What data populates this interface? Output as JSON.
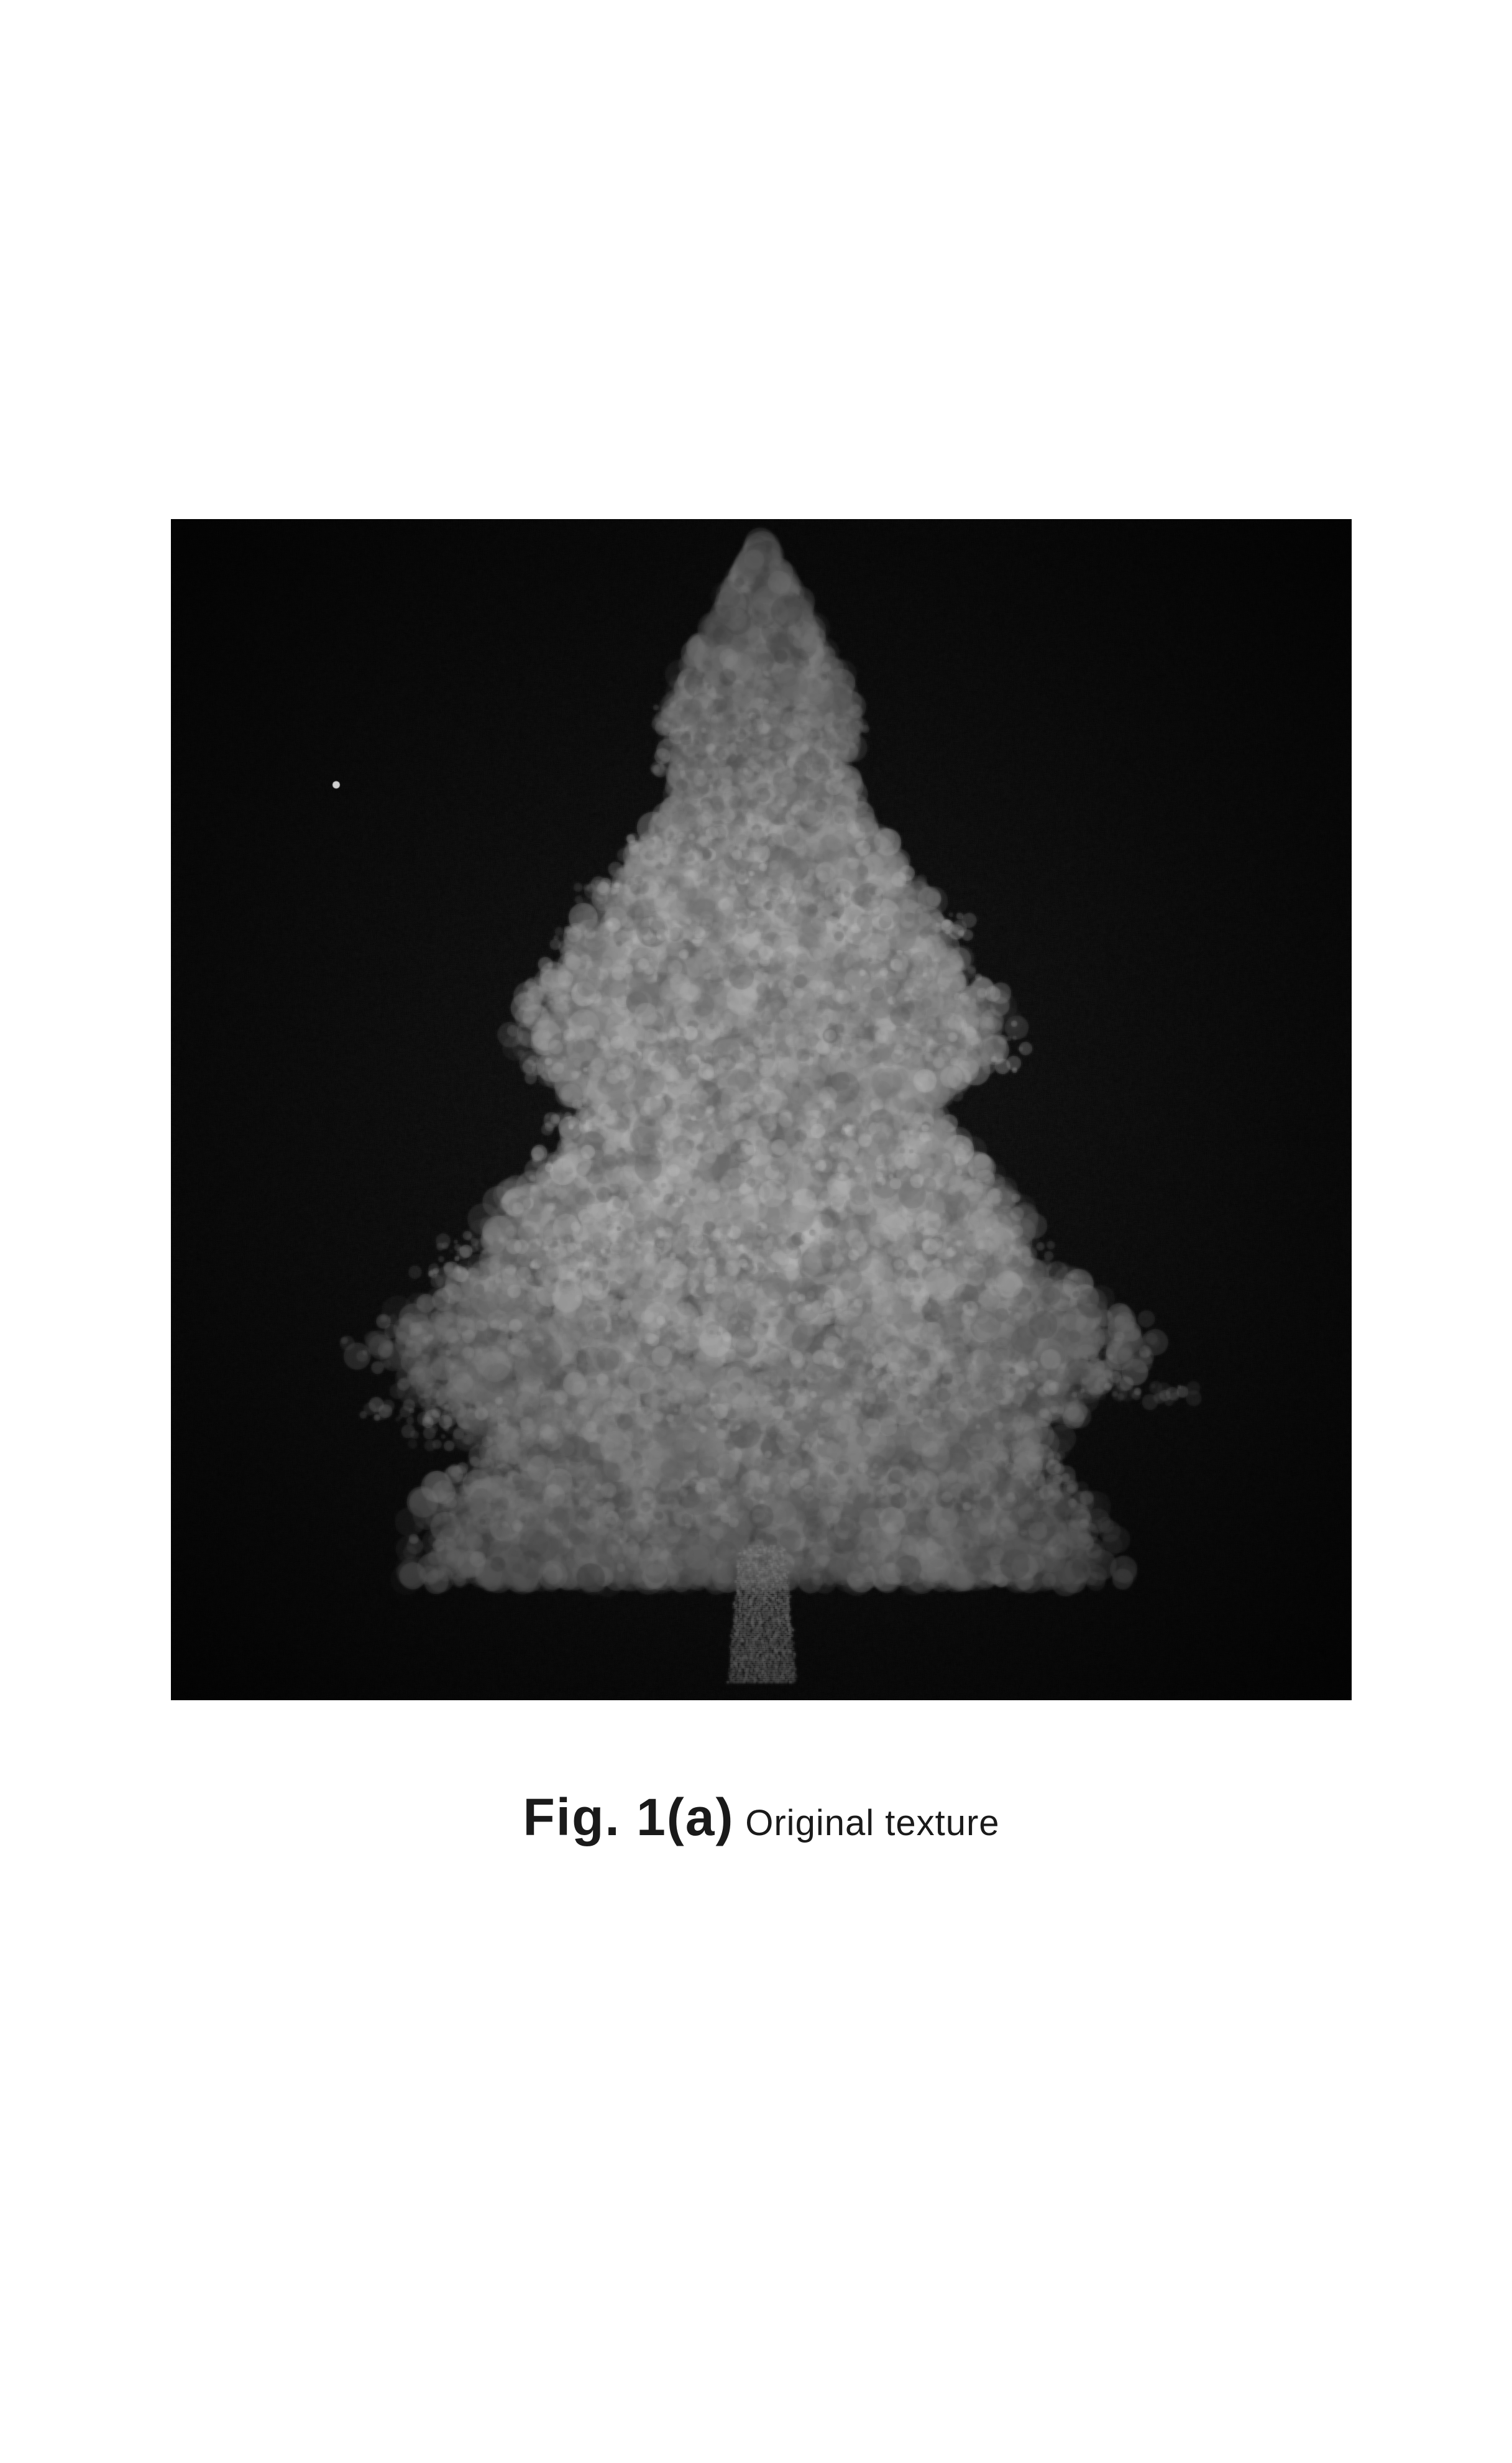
{
  "figure": {
    "label": "Fig. 1(a)",
    "description": "Original texture",
    "image_alt": "tree-texture-grayscale",
    "subject": "conifer-tree"
  }
}
